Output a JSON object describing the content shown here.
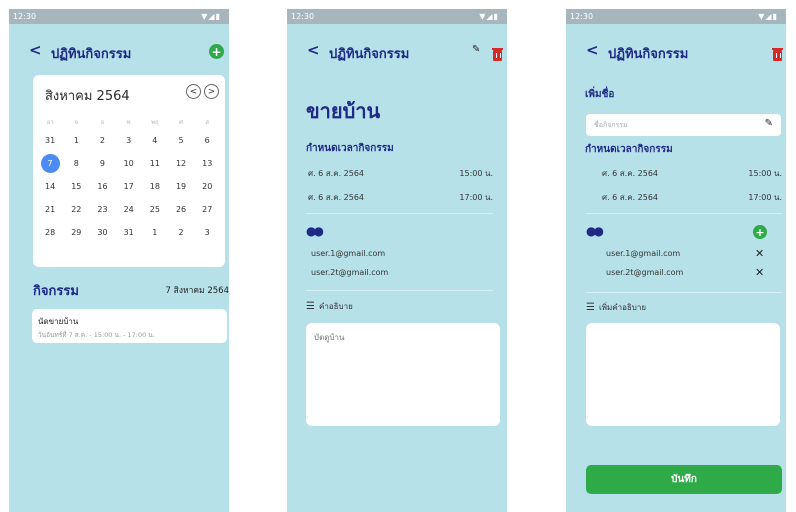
{
  "status_time": "12:30",
  "status_icons": "▼◢▮",
  "app": {
    "back_label": "<",
    "title": "ปฏิทินกิจกรรม"
  },
  "screen1": {
    "calendar": {
      "month_label": "สิงหาคม 2564",
      "prev_label": "<",
      "next_label": ">",
      "weekdays": [
        "อา",
        "จ",
        "อ",
        "พ",
        "พฤ",
        "ศ",
        "ส"
      ],
      "weeks": [
        [
          "31",
          "1",
          "2",
          "3",
          "4",
          "5",
          "6"
        ],
        [
          "7",
          "8",
          "9",
          "10",
          "11",
          "12",
          "13"
        ],
        [
          "14",
          "15",
          "16",
          "17",
          "18",
          "19",
          "20"
        ],
        [
          "21",
          "22",
          "23",
          "24",
          "25",
          "26",
          "27"
        ],
        [
          "28",
          "29",
          "30",
          "31",
          "1",
          "2",
          "3"
        ]
      ],
      "selected": "7"
    },
    "section_title": "กิจกรรม",
    "section_date": "7 สิงหาคม 2564",
    "event": {
      "title": "นัดขายบ้าน",
      "subtitle": "วันอันทร์ที่ 7 ส.ค. - 15:00 น. - 17:00 น."
    }
  },
  "screen2": {
    "headline": "ขายบ้าน",
    "time_heading": "กำหนดเวลากิจกรรม",
    "times": [
      {
        "date": "ศ. 6 ส.ค. 2564",
        "time": "15:00 น."
      },
      {
        "date": "ศ. 6 ส.ค. 2564",
        "time": "17:00 น."
      }
    ],
    "emails": [
      "user.1@gmail.com",
      "user.2t@gmail.com"
    ],
    "desc_label": "คำอธิบาย",
    "desc_text": "บัตดูบ้าน"
  },
  "screen3": {
    "name_heading": "เพิ่มชื่อ",
    "name_placeholder": "ชื่อกิจกรรม",
    "time_heading": "กำหนดเวลากิจกรรม",
    "times": [
      {
        "date": "ศ. 6 ส.ค. 2564",
        "time": "15:00 น."
      },
      {
        "date": "ศ. 6 ส.ค. 2564",
        "time": "17:00 น."
      }
    ],
    "emails": [
      "user.1@gmail.com",
      "user.2t@gmail.com"
    ],
    "desc_label": "เพิ่มคำอธิบาย",
    "save_label": "บันทึก"
  },
  "colors": {
    "background": "#b7e1e9",
    "primary": "#1e2a86",
    "accent": "#2eaa49",
    "danger": "#d62a2a",
    "selected": "#4b8bf2"
  }
}
